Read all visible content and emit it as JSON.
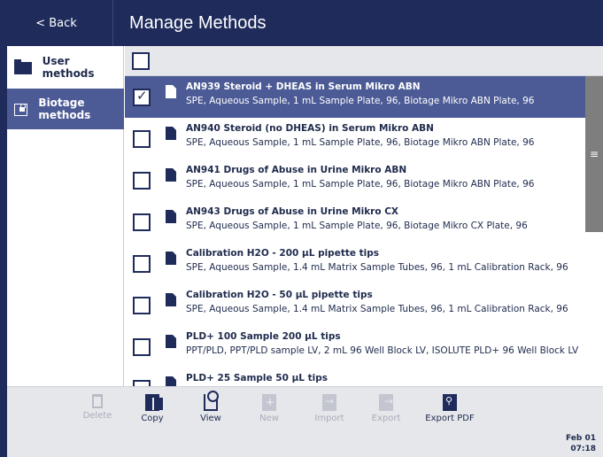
{
  "header": {
    "back_label": "< Back",
    "title": "Manage Methods"
  },
  "sidebar": {
    "items": [
      {
        "label": "User methods",
        "icon": "folder-icon"
      },
      {
        "label": "Biotage methods",
        "icon": "locked-folder-icon"
      }
    ]
  },
  "methods": [
    {
      "name": "AN939 Steroid + DHEAS in Serum Mikro ABN",
      "desc": "SPE, Aqueous Sample, 1 mL Sample Plate, 96, Biotage Mikro ABN Plate, 96",
      "checked": true
    },
    {
      "name": "AN940 Steroid (no DHEAS) in Serum Mikro ABN",
      "desc": "SPE, Aqueous Sample, 1 mL Sample Plate, 96, Biotage Mikro ABN Plate, 96",
      "checked": false
    },
    {
      "name": "AN941 Drugs of Abuse in Urine Mikro ABN",
      "desc": "SPE, Aqueous Sample, 1 mL Sample Plate, 96, Biotage Mikro ABN Plate, 96",
      "checked": false
    },
    {
      "name": "AN943 Drugs of Abuse in Urine Mikro CX",
      "desc": "SPE, Aqueous Sample, 1 mL Sample Plate, 96, Biotage Mikro CX Plate, 96",
      "checked": false
    },
    {
      "name": "Calibration H2O - 200 µL pipette tips",
      "desc": "SPE, Aqueous Sample, 1.4 mL Matrix Sample Tubes, 96, 1 mL Calibration Rack, 96",
      "checked": false
    },
    {
      "name": "Calibration H2O - 50 µL pipette tips",
      "desc": "SPE, Aqueous Sample, 1.4 mL Matrix Sample Tubes, 96, 1 mL Calibration Rack, 96",
      "checked": false
    },
    {
      "name": "PLD+ 100 Sample 200 µL tips",
      "desc": "PPT/PLD, PPT/PLD sample LV, 2 mL 96 Well Block LV, ISOLUTE PLD+ 96 Well Block LV",
      "checked": false
    },
    {
      "name": "PLD+ 25 Sample 50 µL tips",
      "desc": "",
      "checked": false
    }
  ],
  "toolbar": {
    "delete_label": "Delete",
    "copy_label": "Copy",
    "view_label": "View",
    "new_label": "New",
    "import_label": "Import",
    "export_label": "Export",
    "export_pdf_label": "Export PDF"
  },
  "status": {
    "date": "Feb 01",
    "time": "07:18"
  },
  "colors": {
    "primary_dark": "#1f2b5b",
    "selection": "#4c5b96",
    "toolbar_bg": "#e6e7eb"
  }
}
